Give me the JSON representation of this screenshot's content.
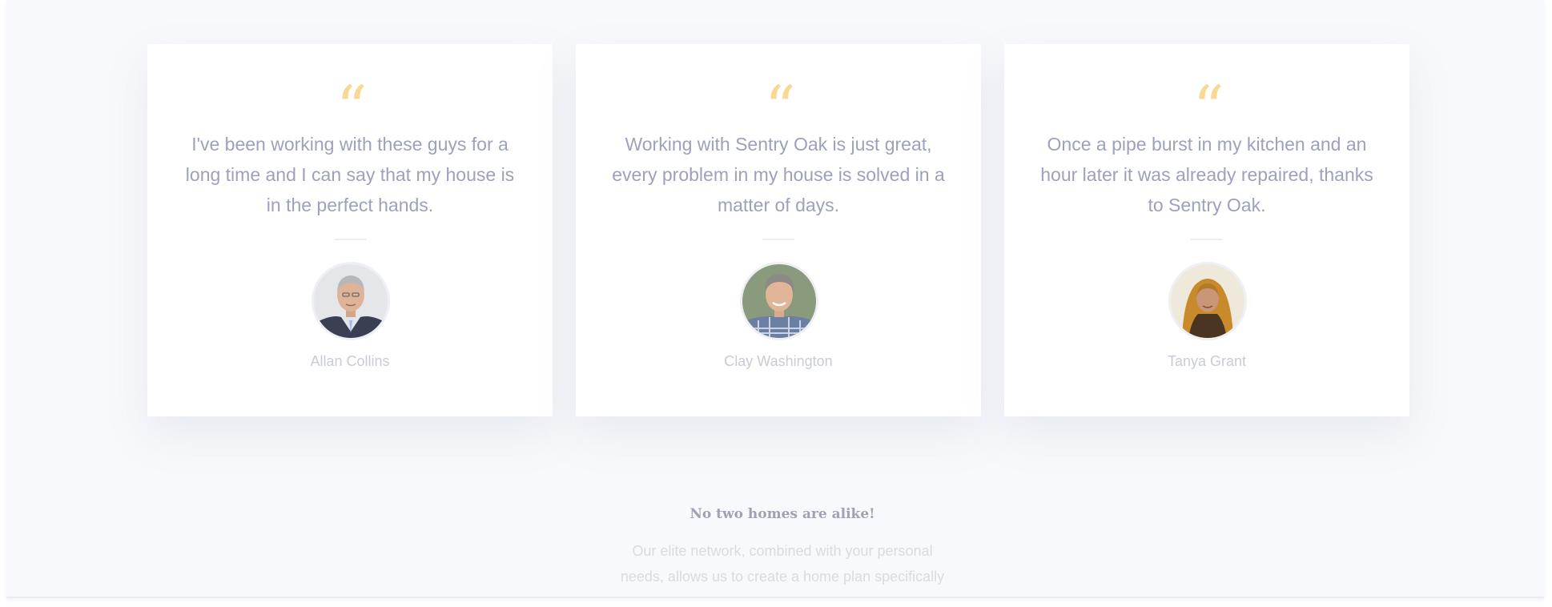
{
  "testimonials": [
    {
      "quote": "I've been working with these guys for a long time and I can say that my house is in the perfect hands.",
      "name": "Allan Collins"
    },
    {
      "quote": "Working with Sentry Oak is just great, every problem in my house is solved in a matter of days.",
      "name": "Clay Washington"
    },
    {
      "quote": "Once a pipe burst in my kitchen and an hour later it was already repaired, thanks to Sentry Oak.",
      "name": "Tanya Grant"
    }
  ],
  "quote_mark": "“",
  "quote_mark_color": "#fad891",
  "promo": {
    "heading": "No two homes are alike!",
    "text_lines": [
      "Our elite network, combined with your personal",
      "needs, allows us to create a home plan specifically"
    ]
  }
}
